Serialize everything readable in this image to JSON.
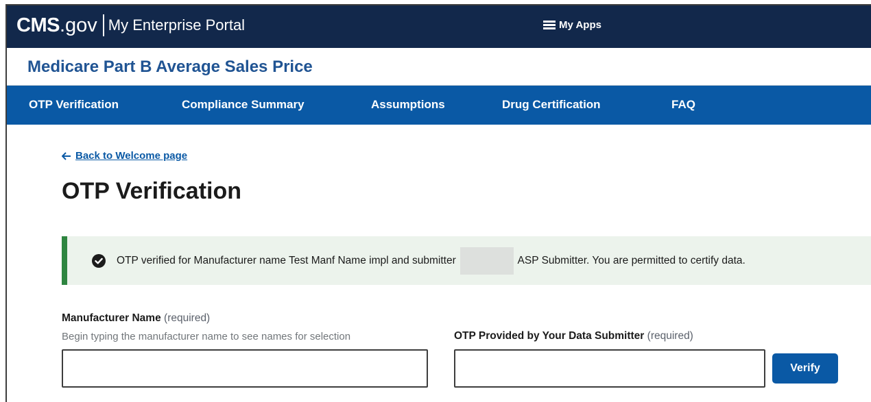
{
  "header": {
    "brand_cms": "CMS",
    "brand_gov": ".gov",
    "portal": "My Enterprise Portal",
    "my_apps": "My Apps"
  },
  "app": {
    "title": "Medicare Part B Average Sales Price"
  },
  "nav": {
    "items": [
      {
        "label": "OTP Verification"
      },
      {
        "label": "Compliance Summary"
      },
      {
        "label": "Assumptions"
      },
      {
        "label": "Drug Certification"
      },
      {
        "label": "FAQ"
      }
    ]
  },
  "page": {
    "back_link": "Back to Welcome page",
    "title": "OTP Verification"
  },
  "alert": {
    "text_before": "OTP verified for Manufacturer name Test Manf Name impl and submitter",
    "text_after": "ASP Submitter. You are permitted to certify data."
  },
  "form": {
    "manufacturer": {
      "label": "Manufacturer Name",
      "required": "(required)",
      "hint": "Begin typing the manufacturer name to see names for selection",
      "value": ""
    },
    "otp": {
      "label": "OTP Provided by Your Data Submitter",
      "required": "(required)",
      "value": ""
    },
    "verify_label": "Verify"
  },
  "colors": {
    "header_bg": "#12284b",
    "nav_bg": "#0a59a5",
    "title_blue": "#205493",
    "success_green": "#2e8540",
    "alert_bg": "#ecf3ec"
  }
}
